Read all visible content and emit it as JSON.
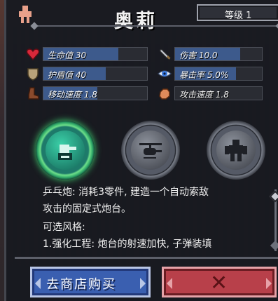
{
  "header": {
    "hero_name": "奥莉",
    "level_label": "等级 1"
  },
  "stats": {
    "left": [
      {
        "label": "生命值 30",
        "icon": "heart-icon",
        "fill": 0.72
      },
      {
        "label": "护盾值 40",
        "icon": "shield-icon",
        "fill": 0.6
      },
      {
        "label": "移动速度 1.8",
        "icon": "boot-icon",
        "fill": 0.52
      }
    ],
    "right": [
      {
        "label": "伤害 10.0",
        "icon": "sword-icon",
        "fill": 0.75
      },
      {
        "label": "暴击率 5.0%",
        "icon": "eye-icon",
        "fill": 0.7
      },
      {
        "label": "攻击速度 1.8",
        "icon": "fist-icon",
        "fill": 0.0
      }
    ]
  },
  "skills": [
    {
      "icon": "turret-icon",
      "selected": true
    },
    {
      "icon": "helicopter-icon",
      "selected": false
    },
    {
      "icon": "mech-icon",
      "selected": false
    }
  ],
  "description": {
    "line1": "乒乓炮: 消耗3零件, 建造一个自动索敌",
    "line2": "攻击的固定式炮台。",
    "line3": "可选风格:",
    "line4": "1.强化工程: 炮台的射速加快, 子弹装填"
  },
  "buttons": {
    "shop_label": "去商店购买",
    "close_label": "✕"
  },
  "colors": {
    "stat_fill": "#3d5a8c",
    "shop_button": "#3a5fb0",
    "close_button": "#b8404a",
    "selected_skill_glow": "#40d070"
  }
}
